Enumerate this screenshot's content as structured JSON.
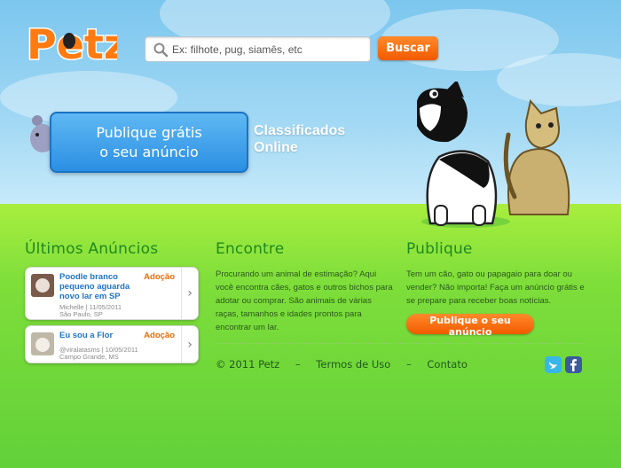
{
  "logo": {
    "text": "Petz"
  },
  "search": {
    "placeholder": "Ex: filhote, pug, siamês, etc",
    "button_label": "Buscar"
  },
  "hero": {
    "banner_line1": "Publique grátis",
    "banner_line2": "o seu anúncio",
    "tagline_line1": "Classificados",
    "tagline_line2": "Online"
  },
  "latest": {
    "title": "Últimos Anúncios",
    "items": [
      {
        "title": "Poodle branco pequeno aguarda novo lar em SP",
        "tag": "Adoção",
        "meta": "Michelle | 11/05/2011",
        "location": "São Paulo, SP"
      },
      {
        "title": "Eu sou a Flor",
        "tag": "Adoção",
        "meta": "@viralatasms | 10/05/2011",
        "location": "Campo Grande, MS"
      }
    ]
  },
  "find": {
    "title": "Encontre",
    "text": "Procurando um animal de estimação? Aqui você encontra cães, gatos e outros bichos para adotar ou comprar. São animais de várias raças, tamanhos e idades prontos para encontrar um lar."
  },
  "publish": {
    "title": "Publique",
    "text": "Tem um cão, gato ou papagaio para doar ou vender? Não importa! Faça um anúncio grátis e se prepare para receber boas notícias.",
    "button_label": "Publique o seu anúncio"
  },
  "footer": {
    "copyright": "© 2011 Petz",
    "sep1": "–",
    "terms": "Termos de Uso",
    "sep2": "–",
    "contact": "Contato"
  },
  "colors": {
    "accent": "#f15a00",
    "title_green": "#1f8a1f",
    "link_blue": "#1f74c8"
  },
  "icons": [
    "search-icon",
    "chevron-right-icon",
    "twitter-icon",
    "facebook-icon"
  ]
}
